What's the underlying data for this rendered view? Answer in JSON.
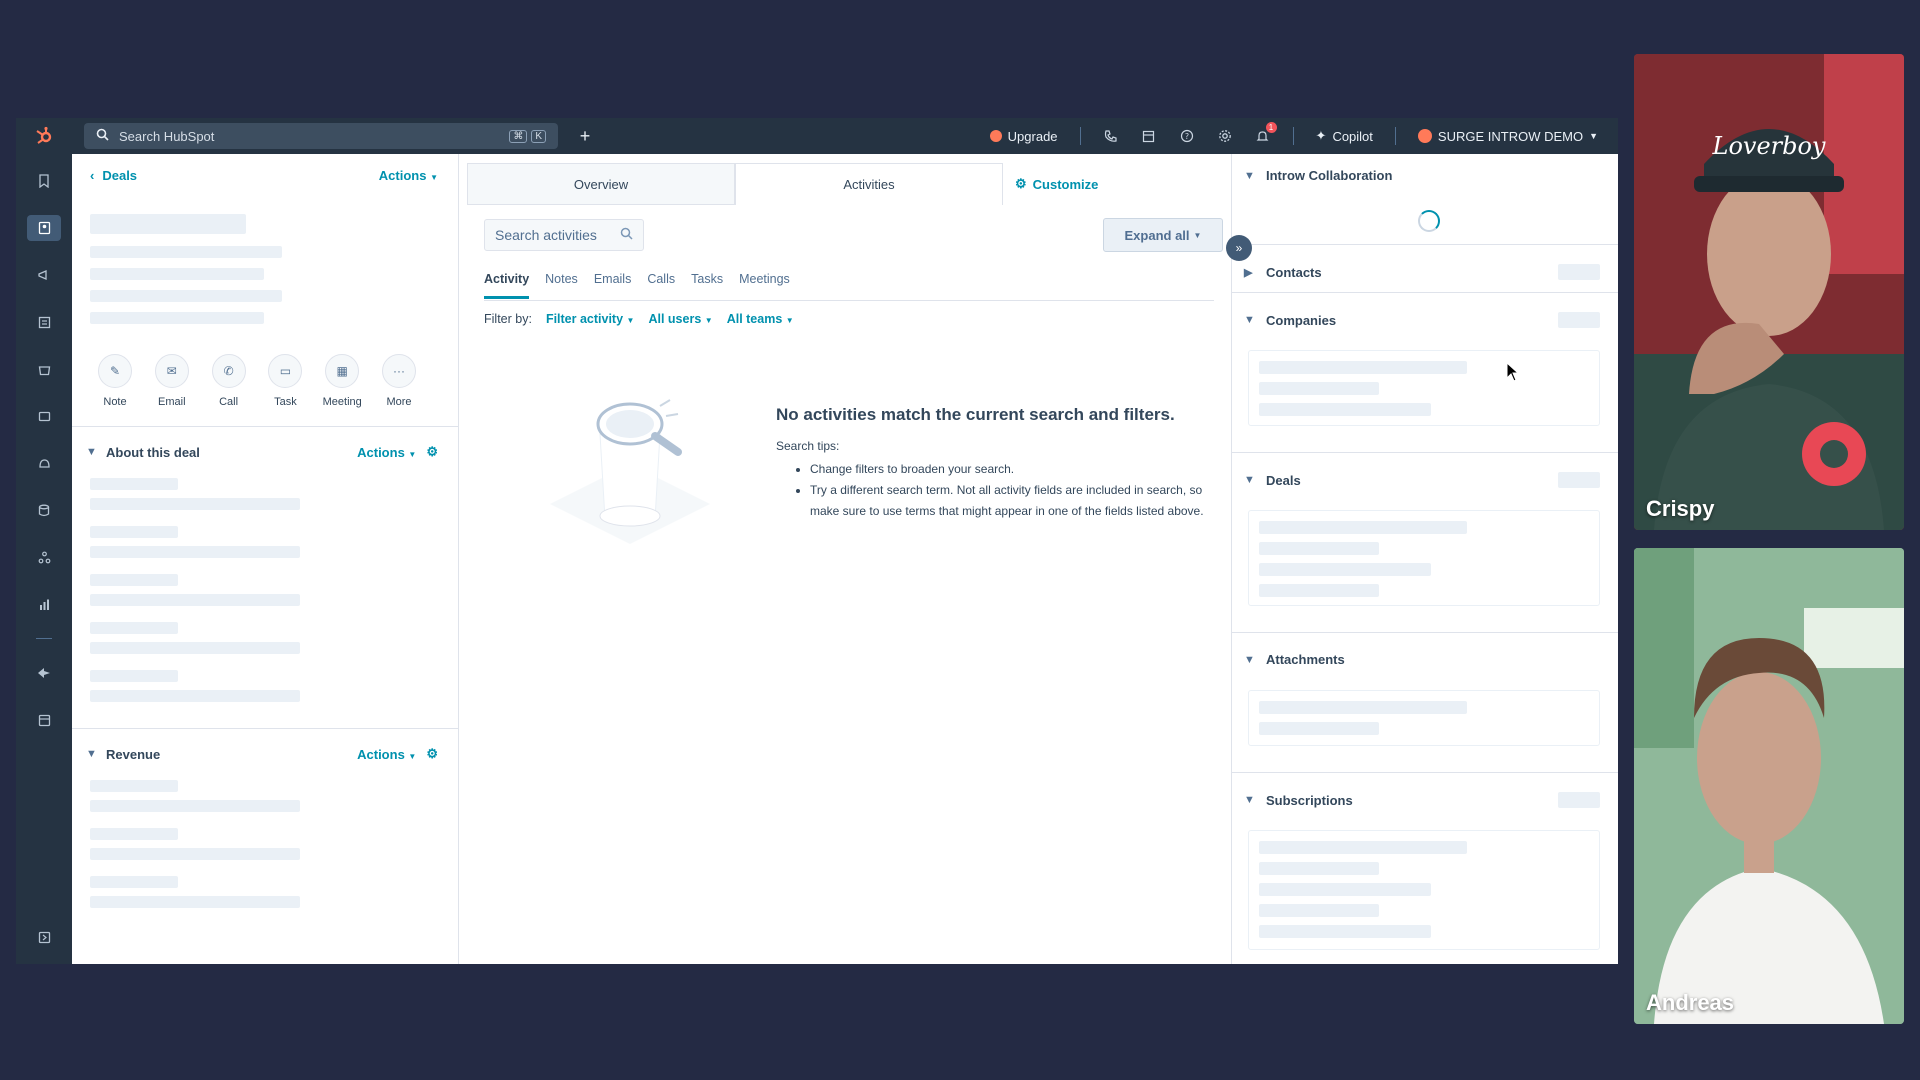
{
  "topbar": {
    "search_placeholder": "Search HubSpot",
    "shortcut_keys": [
      "⌘",
      "K"
    ],
    "upgrade_label": "Upgrade",
    "notification_count": "1",
    "copilot_label": "Copilot",
    "account_name": "SURGE INTROW DEMO"
  },
  "left": {
    "back_label": "Deals",
    "actions_label": "Actions",
    "quick_actions": [
      {
        "label": "Note",
        "icon": "note-icon"
      },
      {
        "label": "Email",
        "icon": "email-icon"
      },
      {
        "label": "Call",
        "icon": "call-icon"
      },
      {
        "label": "Task",
        "icon": "task-icon"
      },
      {
        "label": "Meeting",
        "icon": "meeting-icon"
      },
      {
        "label": "More",
        "icon": "more-icon"
      }
    ],
    "about_title": "About this deal",
    "about_actions": "Actions",
    "revenue_title": "Revenue",
    "revenue_actions": "Actions"
  },
  "middle": {
    "tabs": [
      "Overview",
      "Activities"
    ],
    "active_tab": "Activities",
    "customize_label": "Customize",
    "search_placeholder": "Search activities",
    "expand_label": "Expand all",
    "subtabs": [
      "Activity",
      "Notes",
      "Emails",
      "Calls",
      "Tasks",
      "Meetings"
    ],
    "filter_by_label": "Filter by:",
    "filters": [
      "Filter activity",
      "All users",
      "All teams"
    ],
    "empty_title": "No activities match the current search and filters.",
    "tips_label": "Search tips:",
    "tips": [
      "Change filters to broaden your search.",
      "Try a different search term. Not all activity fields are included in search, so make sure to use terms that might appear in one of the fields listed above."
    ]
  },
  "right": {
    "cards": [
      "Introw Collaboration",
      "Contacts",
      "Companies",
      "Deals",
      "Attachments",
      "Subscriptions"
    ]
  },
  "video": {
    "participants": [
      "Crispy",
      "Andreas"
    ]
  },
  "colors": {
    "background": "#242a44",
    "nav": "#253342",
    "accent": "#0091ae",
    "upgrade": "#ff7a59"
  }
}
